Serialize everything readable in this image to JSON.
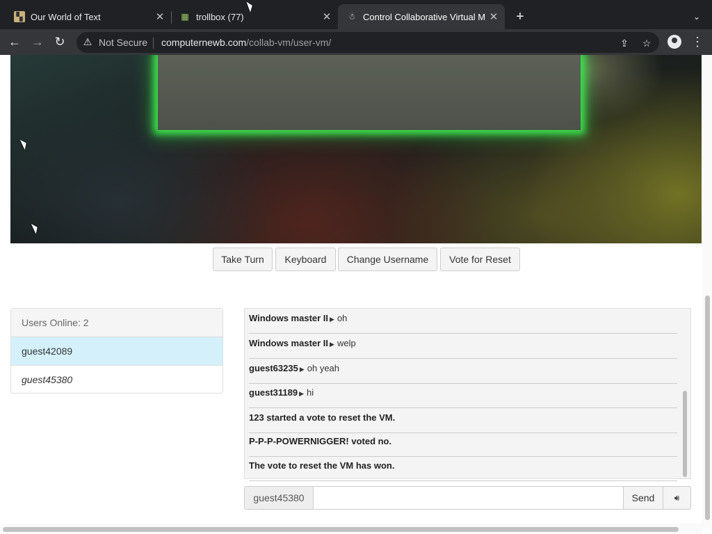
{
  "browser": {
    "tabs": [
      {
        "title": "Our World of Text",
        "icon": "owot-icon"
      },
      {
        "title": "trollbox (77)",
        "icon": "trollbox-icon"
      },
      {
        "title": "Control Collaborative Virtual M",
        "icon": "collabvm-icon",
        "active": true
      }
    ],
    "security_label": "Not Secure",
    "url_host": "computernewb.com",
    "url_path": "/collab-vm/user-vm/"
  },
  "vm": {
    "buttons": {
      "take_turn": "Take Turn",
      "keyboard": "Keyboard",
      "change_username": "Change Username",
      "vote_reset": "Vote for Reset"
    }
  },
  "users": {
    "header": "Users Online: 2",
    "list": [
      "guest42089",
      "guest45380"
    ]
  },
  "chat": {
    "messages": [
      {
        "user": "Windows master II",
        "text": "oh"
      },
      {
        "user": "Windows master II",
        "text": "welp"
      },
      {
        "user": "guest63235",
        "text": "oh yeah"
      },
      {
        "user": "guest31189",
        "text": "hi"
      },
      {
        "system": "123 started a vote to reset the VM."
      },
      {
        "system": "P-P-P-POWERNIGGER! voted no."
      },
      {
        "system": "The vote to reset the VM has won."
      }
    ],
    "username": "guest45380",
    "input_value": "",
    "send_label": "Send"
  }
}
